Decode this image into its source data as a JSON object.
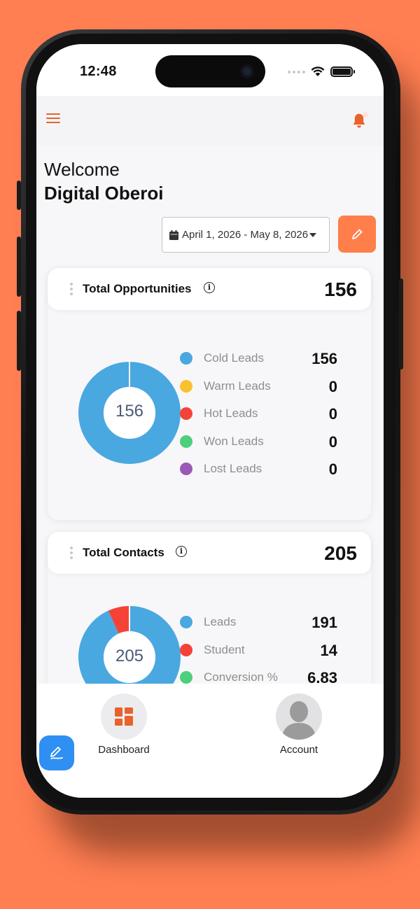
{
  "status_bar": {
    "time": "12:48"
  },
  "header": {
    "menu_icon": "hamburger-menu-icon",
    "notification_icon": "bell-icon"
  },
  "greeting": {
    "welcome": "Welcome",
    "name": "Digital Oberoi"
  },
  "date_filter": {
    "range": "April 1, 2026 - May 8, 2026",
    "calendar_icon": "calendar-icon",
    "caret_icon": "caret-down-icon"
  },
  "edit_button": {
    "icon": "pencil-icon"
  },
  "opportunities": {
    "title": "Total Opportunities",
    "total": "156",
    "center": "156",
    "items": [
      {
        "label": "Cold Leads",
        "value": "156",
        "color": "#4AA8E0"
      },
      {
        "label": "Warm Leads",
        "value": "0",
        "color": "#FBC02D"
      },
      {
        "label": "Hot Leads",
        "value": "0",
        "color": "#F44336"
      },
      {
        "label": "Won Leads",
        "value": "0",
        "color": "#4CD07D"
      },
      {
        "label": "Lost Leads",
        "value": "0",
        "color": "#9B59B6"
      }
    ]
  },
  "contacts": {
    "title": "Total Contacts",
    "total": "205",
    "center": "205",
    "items": [
      {
        "label": "Leads",
        "value": "191",
        "color": "#4AA8E0"
      },
      {
        "label": "Student",
        "value": "14",
        "color": "#F44336"
      },
      {
        "label": "Conversion %",
        "value": "6.83",
        "color": "#4CD07D"
      }
    ]
  },
  "chart_data": [
    {
      "type": "pie",
      "title": "Total Opportunities",
      "categories": [
        "Cold Leads",
        "Warm Leads",
        "Hot Leads",
        "Won Leads",
        "Lost Leads"
      ],
      "values": [
        156,
        0,
        0,
        0,
        0
      ],
      "colors": [
        "#4AA8E0",
        "#FBC02D",
        "#F44336",
        "#4CD07D",
        "#9B59B6"
      ]
    },
    {
      "type": "pie",
      "title": "Total Contacts",
      "categories": [
        "Leads",
        "Student"
      ],
      "values": [
        191,
        14
      ],
      "colors": [
        "#4AA8E0",
        "#F44336"
      ]
    }
  ],
  "bottom_nav": {
    "dashboard": {
      "label": "Dashboard",
      "icon": "dashboard-grid-icon"
    },
    "account": {
      "label": "Account",
      "icon": "user-avatar-icon"
    },
    "fab_icon": "edit-note-icon"
  },
  "colors": {
    "accent": "#E8622B",
    "edit_button_bg": "#FF7E4A",
    "fab_bg": "#2F8FF2",
    "page_bg": "#FF7E52"
  }
}
